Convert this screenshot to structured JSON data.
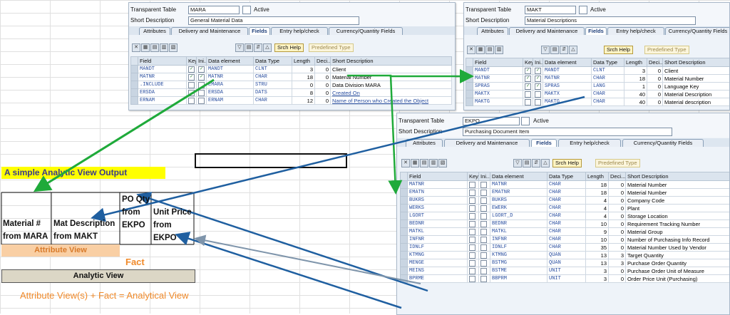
{
  "mara": {
    "table_label": "Transparent Table",
    "table_name": "MARA",
    "status": "Active",
    "desc_label": "Short Description",
    "description": "General Material Data",
    "tabs": [
      "Attributes",
      "Delivery and Maintenance",
      "Fields",
      "Entry help/check",
      "Currency/Quantity Fields"
    ],
    "toolbar": {
      "srch_help": "Srch Help",
      "predefined_type": "Predefined Type"
    },
    "columns": [
      "Field",
      "Key",
      "Ini...",
      "Data element",
      "Data Type",
      "Length",
      "Deci...",
      "Short Description"
    ],
    "rows": [
      {
        "field": "MANDT",
        "key": true,
        "ini": true,
        "element": "MANDT",
        "type": "CLNT",
        "length": "3",
        "deci": "0",
        "desc": "Client"
      },
      {
        "field": "MATNR",
        "key": true,
        "ini": true,
        "element": "MATNR",
        "type": "CHAR",
        "length": "18",
        "deci": "0",
        "desc": "Material Number"
      },
      {
        "field": ".INCLUDE",
        "key": false,
        "ini": false,
        "element": "EMARA",
        "type": "STRU",
        "length": "0",
        "deci": "0",
        "desc": "Data Division MARA"
      },
      {
        "field": "ERSDA",
        "key": false,
        "ini": false,
        "element": "ERSDA",
        "type": "DATS",
        "length": "8",
        "deci": "0",
        "desc": "Created On"
      },
      {
        "field": "ERNAM",
        "key": false,
        "ini": false,
        "element": "ERNAM",
        "type": "CHAR",
        "length": "12",
        "deci": "0",
        "desc": "Name of Person who Created the Object"
      }
    ]
  },
  "makt": {
    "table_label": "Transparent Table",
    "table_name": "MAKT",
    "status": "Active",
    "desc_label": "Short Description",
    "description": "Material Descriptions",
    "tabs": [
      "Attributes",
      "Delivery and Maintenance",
      "Fields",
      "Entry help/check",
      "Currency/Quantity Fields"
    ],
    "toolbar": {
      "srch_help": "Srch Help",
      "predefined_type": "Predefined Type"
    },
    "columns": [
      "Field",
      "Key",
      "Ini...",
      "Data element",
      "Data Type",
      "Length",
      "Deci...",
      "Short Description"
    ],
    "rows": [
      {
        "field": "MANDT",
        "key": true,
        "ini": true,
        "element": "MANDT",
        "type": "CLNT",
        "length": "3",
        "deci": "0",
        "desc": "Client"
      },
      {
        "field": "MATNR",
        "key": true,
        "ini": true,
        "element": "MATNR",
        "type": "CHAR",
        "length": "18",
        "deci": "0",
        "desc": "Material Number"
      },
      {
        "field": "SPRAS",
        "key": true,
        "ini": true,
        "element": "SPRAS",
        "type": "LANG",
        "length": "1",
        "deci": "0",
        "desc": "Language Key"
      },
      {
        "field": "MAKTX",
        "key": false,
        "ini": false,
        "element": "MAKTX",
        "type": "CHAR",
        "length": "40",
        "deci": "0",
        "desc": "Material Description"
      },
      {
        "field": "MAKTG",
        "key": false,
        "ini": false,
        "element": "MAKTG",
        "type": "CHAR",
        "length": "40",
        "deci": "0",
        "desc": "Material description"
      }
    ]
  },
  "ekpo": {
    "table_label": "Transparent Table",
    "table_name": "EKPO",
    "status": "Active",
    "desc_label": "Short Description",
    "description": "Purchasing Document Item",
    "tabs": [
      "Attributes",
      "Delivery and Maintenance",
      "Fields",
      "Entry help/check",
      "Currency/Quantity Fields"
    ],
    "toolbar": {
      "srch_help": "Srch Help",
      "predefined_type": "Predefined Type"
    },
    "columns": [
      "Field",
      "Key",
      "Ini...",
      "Data element",
      "Data Type",
      "Length",
      "Deci...",
      "Short Description"
    ],
    "rows": [
      {
        "field": "MATNR",
        "element": "MATNR",
        "type": "CHAR",
        "length": "18",
        "deci": "0",
        "desc": "Material Number"
      },
      {
        "field": "EMATN",
        "element": "EMATNR",
        "type": "CHAR",
        "length": "18",
        "deci": "0",
        "desc": "Material Number"
      },
      {
        "field": "BUKRS",
        "element": "BUKRS",
        "type": "CHAR",
        "length": "4",
        "deci": "0",
        "desc": "Company Code"
      },
      {
        "field": "WERKS",
        "element": "EWERK",
        "type": "CHAR",
        "length": "4",
        "deci": "0",
        "desc": "Plant"
      },
      {
        "field": "LGORT",
        "element": "LGORT_D",
        "type": "CHAR",
        "length": "4",
        "deci": "0",
        "desc": "Storage Location"
      },
      {
        "field": "BEDNR",
        "element": "BEDNR",
        "type": "CHAR",
        "length": "10",
        "deci": "0",
        "desc": "Requirement Tracking Number"
      },
      {
        "field": "MATKL",
        "element": "MATKL",
        "type": "CHAR",
        "length": "9",
        "deci": "0",
        "desc": "Material Group"
      },
      {
        "field": "INFNR",
        "element": "INFNR",
        "type": "CHAR",
        "length": "10",
        "deci": "0",
        "desc": "Number of Purchasing Info Record"
      },
      {
        "field": "IDNLF",
        "element": "IDNLF",
        "type": "CHAR",
        "length": "35",
        "deci": "0",
        "desc": "Material Number Used by Vendor"
      },
      {
        "field": "KTMNG",
        "element": "KTMNG",
        "type": "QUAN",
        "length": "13",
        "deci": "3",
        "desc": "Target Quantity"
      },
      {
        "field": "MENGE",
        "element": "BSTMG",
        "type": "QUAN",
        "length": "13",
        "deci": "3",
        "desc": "Purchase Order Quantity"
      },
      {
        "field": "MEINS",
        "element": "BSTME",
        "type": "UNIT",
        "length": "3",
        "deci": "0",
        "desc": "Purchase Order Unit of Measure"
      },
      {
        "field": "BPRME",
        "element": "BBPRM",
        "type": "UNIT",
        "length": "3",
        "deci": "0",
        "desc": "Order Price Unit (Purchasing)"
      }
    ]
  },
  "diagram": {
    "banner": "A simple Analytic View Output",
    "col1": [
      "Material #",
      "from MARA"
    ],
    "col2": [
      "Mat Description",
      "from MAKT"
    ],
    "col3": [
      "PO Qty",
      "from",
      "EKPO"
    ],
    "col4": [
      "Unit Price",
      "from",
      "EKPO"
    ],
    "attribute_view": "Attribute View",
    "fact": "Fact",
    "analytic_view": "Analytic View",
    "formula": "Attribute View(s) + Fact = Analytical View"
  },
  "colors": {
    "green_arrow": "#1faa3a",
    "blue_arrow": "#1f5fa0",
    "grey_arrow": "#7f95ab",
    "banner": "#ffff00",
    "attribute": "#f9cfa4",
    "orange_text": "#f08a2a"
  },
  "icons": [
    "delete-icon",
    "table-icon",
    "copy-icon",
    "paste-icon",
    "insert-row-icon",
    "delete-row-icon",
    "find-icon",
    "sort-icon",
    "filter-icon"
  ]
}
